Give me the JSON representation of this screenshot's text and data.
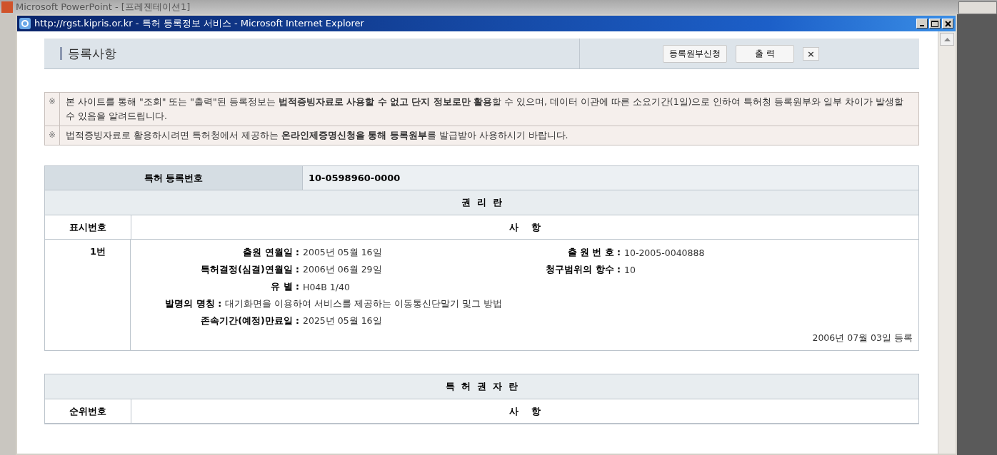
{
  "background_app": {
    "title": "Microsoft PowerPoint - [프레젠테이션1]"
  },
  "window": {
    "title": "http://rgst.kipris.or.kr - 특허 등록정보 서비스 - Microsoft Internet Explorer"
  },
  "page": {
    "heading": "등록사항",
    "buttons": [
      {
        "kind": "text",
        "label": "등록원부신청"
      },
      {
        "kind": "text",
        "label": "출 력"
      },
      {
        "kind": "close",
        "label": "×"
      }
    ]
  },
  "notices": [
    {
      "mark": "※",
      "text": "본 사이트를 통해 \"조회\" 또는 \"출력\"된 등록정보는 **법적증빙자료로 사용할 수 없고 단지 정보로만 활용**할 수 있으며, 데이터 이관에 따른 소요기간(1일)으로 인하여 특허청 등록원부와 일부 차이가 발생할 수 있음을 알려드립니다."
    },
    {
      "mark": "※",
      "text": "법적증빙자료로 활용하시려면 특허청에서 제공하는 **온라인제증명신청을 통해 등록원부**를 발급받아 사용하시기 바랍니다."
    }
  ],
  "registration": {
    "label": "특허 등록번호",
    "value": "10-0598960-0000"
  },
  "rights_table": {
    "title": "권  리  란",
    "columns": [
      "표시번호",
      "사    항"
    ],
    "rows": [
      {
        "index": "1번",
        "fields": [
          {
            "label": "출원 연월일 :",
            "value": "2005년 05월 16일"
          },
          {
            "label": "특허결정(심결)연월일 :",
            "value": "2006년 06월 29일"
          },
          {
            "label": "유 별 :",
            "value": "H04B 1/40"
          },
          {
            "label": "발명의 명칭 :",
            "value": "대기화면을 이용하여 서비스를 제공하는 이동통신단말기 및그 방법"
          },
          {
            "label": "존속기간(예정)만료일 :",
            "value": "2025년 05월 16일"
          }
        ],
        "side_fields": [
          {
            "label": "출 원 번 호 :",
            "value": "10-2005-0040888"
          },
          {
            "label": "청구범위의 항수 :",
            "value": "10"
          }
        ],
        "registered": "2006년 07월 03일 등록"
      }
    ]
  },
  "holders_table": {
    "title": "특  허  권  자  란",
    "columns": [
      "순위번호",
      "사    항"
    ]
  }
}
